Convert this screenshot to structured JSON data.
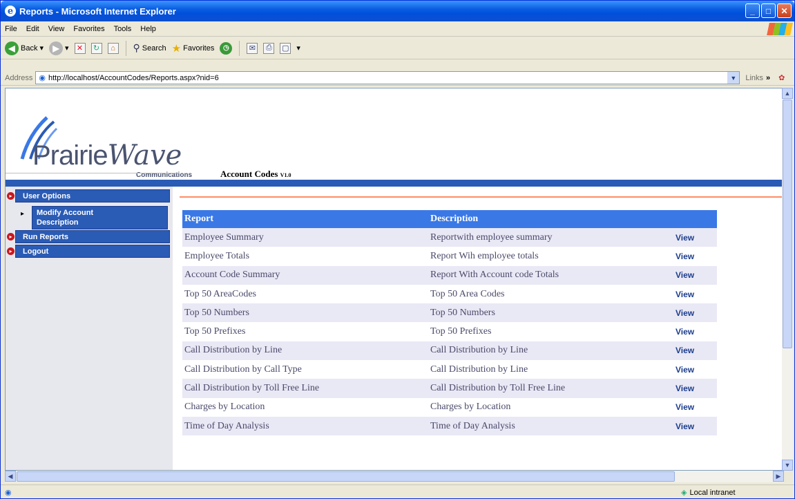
{
  "window": {
    "title": "Reports - Microsoft Internet Explorer"
  },
  "menu": [
    "File",
    "Edit",
    "View",
    "Favorites",
    "Tools",
    "Help"
  ],
  "toolbar": {
    "back": "Back",
    "search": "Search",
    "favorites": "Favorites"
  },
  "address": {
    "label": "Address",
    "url": "http://localhost/AccountCodes/Reports.aspx?nid=6",
    "links": "Links"
  },
  "logo": {
    "word": "Prairie",
    "word_italic": "Wave",
    "sub": "Communications"
  },
  "page": {
    "title": "Account Codes",
    "version": "V1.0"
  },
  "nav": {
    "user_options": "User Options",
    "modify_line1": "Modify Account",
    "modify_line2": "Description",
    "run_reports": "Run Reports",
    "logout": "Logout"
  },
  "table": {
    "headers": [
      "Report",
      "Description"
    ],
    "rows": [
      {
        "report": "Employee Summary",
        "description": "Reportwith employee summary",
        "action": "View"
      },
      {
        "report": "Employee Totals",
        "description": "Report Wih employee totals",
        "action": "View"
      },
      {
        "report": "Account Code Summary",
        "description": "Report With Account code Totals",
        "action": "View"
      },
      {
        "report": "Top 50 AreaCodes",
        "description": "Top 50 Area Codes",
        "action": "View"
      },
      {
        "report": "Top 50 Numbers",
        "description": "Top 50 Numbers",
        "action": "View"
      },
      {
        "report": "Top 50 Prefixes",
        "description": "Top 50 Prefixes",
        "action": "View"
      },
      {
        "report": "Call Distribution by Line",
        "description": "Call Distribution by Line",
        "action": "View"
      },
      {
        "report": "Call Distribution by Call Type",
        "description": "Call Distribution by Line",
        "action": "View"
      },
      {
        "report": "Call Distribution by Toll Free Line",
        "description": "Call Distribution by Toll Free Line",
        "action": "View"
      },
      {
        "report": "Charges by Location",
        "description": "Charges by Location",
        "action": "View"
      },
      {
        "report": "Time of Day Analysis",
        "description": "Time of Day Analysis",
        "action": "View"
      }
    ]
  },
  "status": {
    "zone": "Local intranet"
  },
  "colors": {
    "accent": "#2a5bb5",
    "header": "#3a78e6",
    "row_alt": "#e9e8f5",
    "divider": "#ff8c64"
  }
}
